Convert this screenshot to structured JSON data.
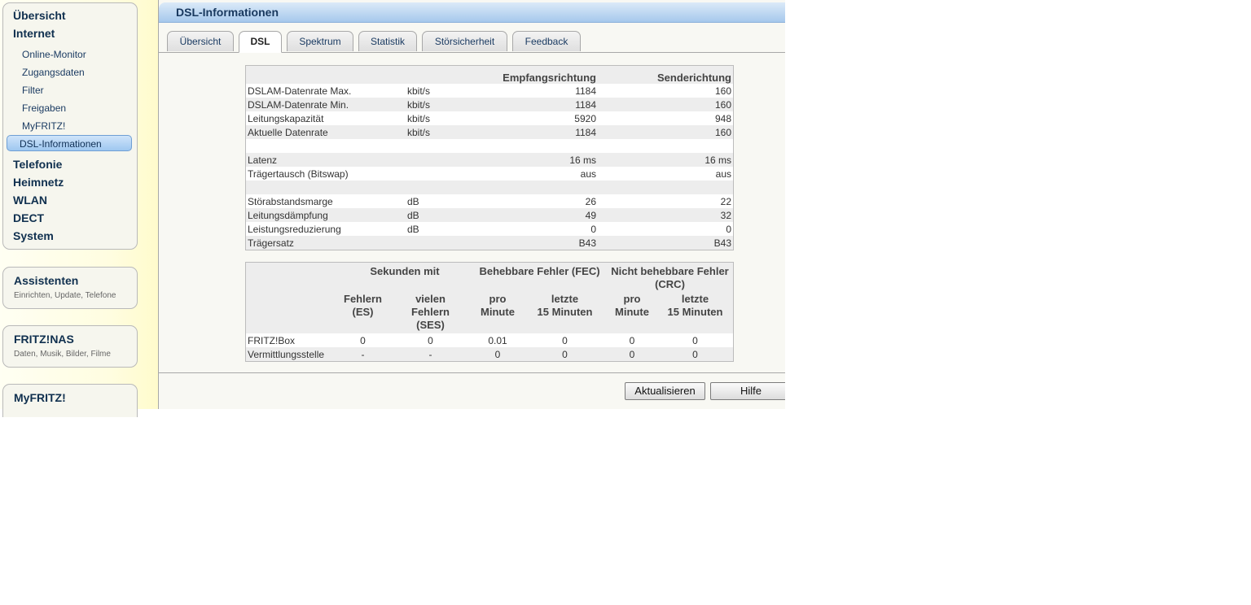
{
  "nav": {
    "top": [
      {
        "label": "Übersicht"
      },
      {
        "label": "Internet"
      },
      {
        "label": "Telefonie"
      },
      {
        "label": "Heimnetz"
      },
      {
        "label": "WLAN"
      },
      {
        "label": "DECT"
      },
      {
        "label": "System"
      }
    ],
    "internet_sub": [
      {
        "label": "Online-Monitor"
      },
      {
        "label": "Zugangsdaten"
      },
      {
        "label": "Filter"
      },
      {
        "label": "Freigaben"
      },
      {
        "label": "MyFRITZ!"
      },
      {
        "label": "DSL-Informationen",
        "active": true
      }
    ]
  },
  "boxes": {
    "assistenten": {
      "title": "Assistenten",
      "subtitle": "Einrichten, Update, Telefone"
    },
    "fritznas": {
      "title": "FRITZ!NAS",
      "subtitle": "Daten, Musik, Bilder, Filme"
    },
    "myfritz": {
      "title": "MyFRITZ!"
    }
  },
  "page": {
    "title": "DSL-Informationen"
  },
  "tabs": [
    {
      "label": "Übersicht"
    },
    {
      "label": "DSL",
      "active": true
    },
    {
      "label": "Spektrum"
    },
    {
      "label": "Statistik"
    },
    {
      "label": "Störsicherheit"
    },
    {
      "label": "Feedback"
    }
  ],
  "table1": {
    "headers": {
      "downstream": "Empfangsrichtung",
      "upstream": "Senderichtung"
    },
    "rows": [
      {
        "name": "DSLAM-Datenrate Max.",
        "unit": "kbit/s",
        "down": "1184",
        "up": "160"
      },
      {
        "name": "DSLAM-Datenrate Min.",
        "unit": "kbit/s",
        "down": "1184",
        "up": "160"
      },
      {
        "name": "Leitungskapazität",
        "unit": "kbit/s",
        "down": "5920",
        "up": "948"
      },
      {
        "name": "Aktuelle Datenrate",
        "unit": "kbit/s",
        "down": "1184",
        "up": "160"
      },
      {
        "name": "",
        "unit": "",
        "down": "",
        "up": ""
      },
      {
        "name": "Latenz",
        "unit": "",
        "down": "16 ms",
        "up": "16 ms"
      },
      {
        "name": "Trägertausch (Bitswap)",
        "unit": "",
        "down": "aus",
        "up": "aus"
      },
      {
        "name": "",
        "unit": "",
        "down": "",
        "up": ""
      },
      {
        "name": "Störabstandsmarge",
        "unit": "dB",
        "down": "26",
        "up": "22"
      },
      {
        "name": "Leitungsdämpfung",
        "unit": "dB",
        "down": "49",
        "up": "32"
      },
      {
        "name": "Leistungsreduzierung",
        "unit": "dB",
        "down": "0",
        "up": "0"
      },
      {
        "name": "Trägersatz",
        "unit": "",
        "down": "B43",
        "up": "B43"
      }
    ]
  },
  "table2": {
    "group_headers": {
      "seconds": "Sekunden mit",
      "fec": "Behebbare Fehler (FEC)",
      "crc_line1": "Nicht behebbare Fehler",
      "crc_line2": "(CRC)"
    },
    "sub_headers": {
      "es_1": "Fehlern",
      "es_2": "(ES)",
      "ses_1": "vielen",
      "ses_2": "Fehlern",
      "ses_3": "(SES)",
      "fec_min_1": "pro",
      "fec_min_2": "Minute",
      "fec_15_1": "letzte",
      "fec_15_2": "15 Minuten",
      "crc_min_1": "pro",
      "crc_min_2": "Minute",
      "crc_15_1": "letzte",
      "crc_15_2": "15 Minuten"
    },
    "rows": [
      {
        "name": "FRITZ!Box",
        "es": "0",
        "ses": "0",
        "fec_min": "0.01",
        "fec_15": "0",
        "crc_min": "0",
        "crc_15": "0"
      },
      {
        "name": "Vermittlungsstelle",
        "es": "-",
        "ses": "-",
        "fec_min": "0",
        "fec_15": "0",
        "crc_min": "0",
        "crc_15": "0"
      }
    ]
  },
  "buttons": {
    "refresh": "Aktualisieren",
    "help": "Hilfe"
  }
}
